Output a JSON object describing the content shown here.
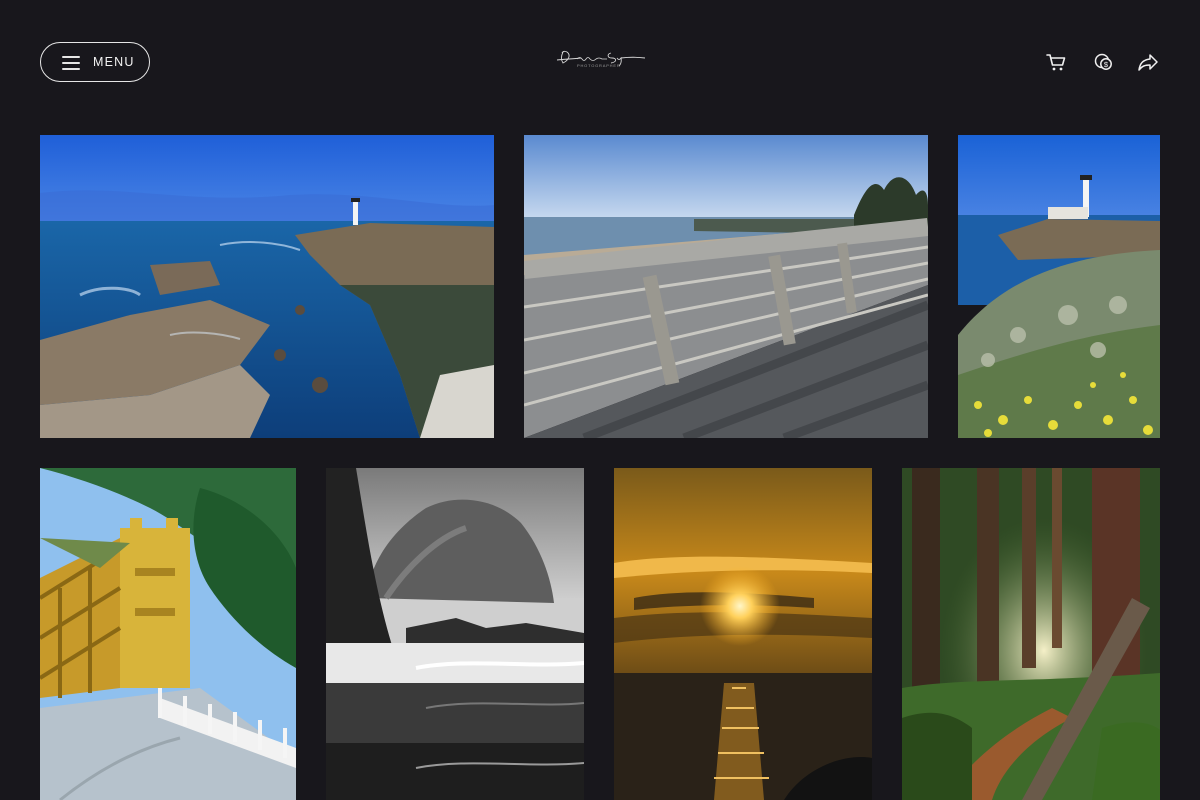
{
  "header": {
    "menu_label": "MENU",
    "logo_subtext": "PHOTOGRAPHER"
  },
  "icons": {
    "cart": "cart-icon",
    "currency": "currency-icon",
    "share": "share-icon"
  },
  "colors": {
    "background": "#18171c",
    "text": "#ffffff",
    "border": "#e6e6e6"
  },
  "gallery": [
    {
      "subject": "point-arena-lighthouse-coast"
    },
    {
      "subject": "beach-boardwalk"
    },
    {
      "subject": "lighthouse-wildflowers"
    },
    {
      "subject": "tower-bridge-sacramento"
    },
    {
      "subject": "sea-stack-black-white"
    },
    {
      "subject": "ocean-sunset"
    },
    {
      "subject": "redwood-forest-trail"
    }
  ]
}
